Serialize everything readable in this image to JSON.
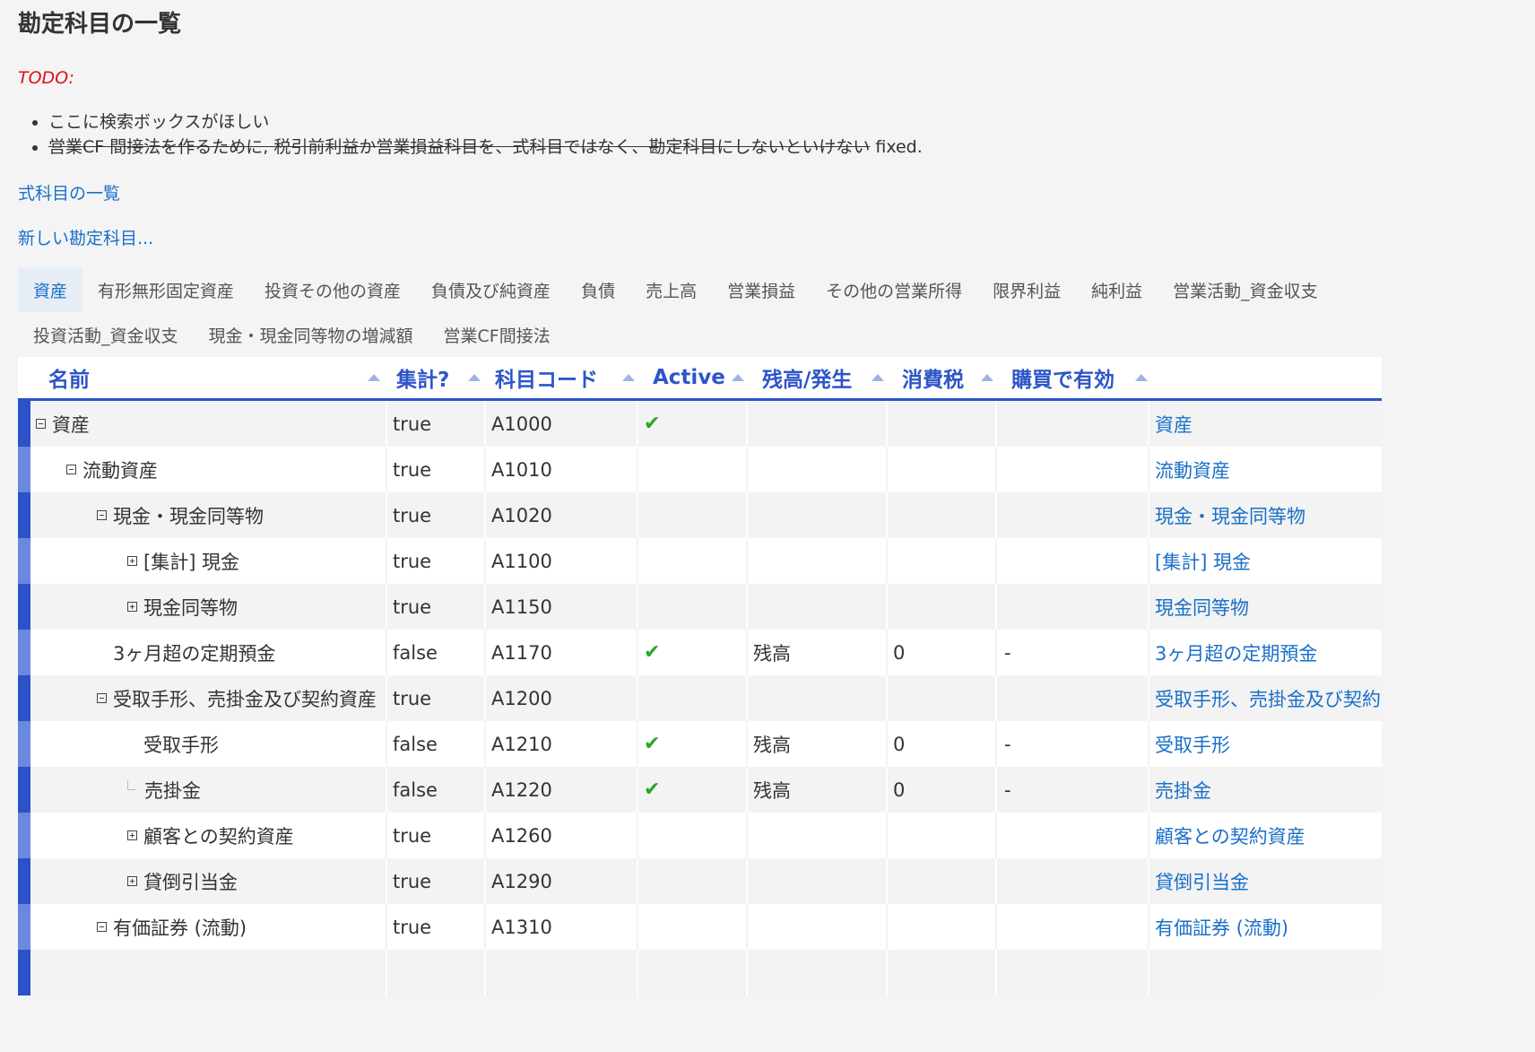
{
  "page": {
    "title": "勘定科目の一覧"
  },
  "todo": {
    "label": "TODO:",
    "items": [
      {
        "text": "ここに検索ボックスがほしい",
        "strike": "",
        "suffix": ""
      },
      {
        "text": "",
        "strike": "営業CF 間接法を作るために, 税引前利益か営業損益科目を、式科目ではなく、勘定科目にしないといけない",
        "suffix": " fixed."
      }
    ]
  },
  "links": {
    "formula_list": "式科目の一覧",
    "new_account": "新しい勘定科目..."
  },
  "tabs": [
    {
      "label": "資産",
      "active": true
    },
    {
      "label": "有形無形固定資産"
    },
    {
      "label": "投資その他の資産"
    },
    {
      "label": "負債及び純資産"
    },
    {
      "label": "負債"
    },
    {
      "label": "売上高"
    },
    {
      "label": "営業損益"
    },
    {
      "label": "その他の営業所得"
    },
    {
      "label": "限界利益"
    },
    {
      "label": "純利益"
    },
    {
      "label": "営業活動_資金収支"
    },
    {
      "label": "投資活動_資金収支"
    },
    {
      "label": "現金・現金同等物の増減額"
    },
    {
      "label": "営業CF間接法"
    }
  ],
  "columns": {
    "name": "名前",
    "aggregate": "集計?",
    "code": "科目コード",
    "active": "Active",
    "balance_type": "残高/発生",
    "tax": "消費税",
    "purchase": "購買で有効"
  },
  "icons": {
    "active_check": "✔"
  },
  "colors": {
    "accent": "#2b52c7",
    "link": "#1a6fc9",
    "todo": "#e01010",
    "check": "#2aa52a"
  },
  "rows": [
    {
      "indent": 0,
      "toggle": "minus",
      "name": "資産",
      "aggregate": "true",
      "code": "A1000",
      "active": true,
      "balance": "",
      "tax": "",
      "purchase": "",
      "link": "資産"
    },
    {
      "indent": 1,
      "toggle": "minus",
      "name": "流動資産",
      "aggregate": "true",
      "code": "A1010",
      "active": false,
      "balance": "",
      "tax": "",
      "purchase": "",
      "link": "流動資産"
    },
    {
      "indent": 2,
      "toggle": "minus",
      "name": "現金・現金同等物",
      "aggregate": "true",
      "code": "A1020",
      "active": false,
      "balance": "",
      "tax": "",
      "purchase": "",
      "link": "現金・現金同等物"
    },
    {
      "indent": 3,
      "toggle": "plus",
      "name": "[集計] 現金",
      "aggregate": "true",
      "code": "A1100",
      "active": false,
      "balance": "",
      "tax": "",
      "purchase": "",
      "link": "[集計] 現金"
    },
    {
      "indent": 3,
      "toggle": "plus",
      "name": "現金同等物",
      "aggregate": "true",
      "code": "A1150",
      "active": false,
      "balance": "",
      "tax": "",
      "purchase": "",
      "link": "現金同等物"
    },
    {
      "indent": 2,
      "toggle": "none",
      "name": "3ヶ月超の定期預金",
      "aggregate": "false",
      "code": "A1170",
      "active": true,
      "balance": "残高",
      "tax": "0",
      "purchase": "-",
      "link": "3ヶ月超の定期預金"
    },
    {
      "indent": 2,
      "toggle": "minus",
      "name": "受取手形、売掛金及び契約資産",
      "aggregate": "true",
      "code": "A1200",
      "active": false,
      "balance": "",
      "tax": "",
      "purchase": "",
      "link": "受取手形、売掛金及び契約資産"
    },
    {
      "indent": 3,
      "toggle": "none",
      "name": "受取手形",
      "aggregate": "false",
      "code": "A1210",
      "active": true,
      "balance": "残高",
      "tax": "0",
      "purchase": "-",
      "link": "受取手形"
    },
    {
      "indent": 3,
      "toggle": "leaf",
      "name": "売掛金",
      "aggregate": "false",
      "code": "A1220",
      "active": true,
      "balance": "残高",
      "tax": "0",
      "purchase": "-",
      "link": "売掛金"
    },
    {
      "indent": 3,
      "toggle": "plus",
      "name": "顧客との契約資産",
      "aggregate": "true",
      "code": "A1260",
      "active": false,
      "balance": "",
      "tax": "",
      "purchase": "",
      "link": "顧客との契約資産"
    },
    {
      "indent": 3,
      "toggle": "plus",
      "name": "貸倒引当金",
      "aggregate": "true",
      "code": "A1290",
      "active": false,
      "balance": "",
      "tax": "",
      "purchase": "",
      "link": "貸倒引当金"
    },
    {
      "indent": 2,
      "toggle": "minus",
      "name": "有価証券 (流動)",
      "aggregate": "true",
      "code": "A1310",
      "active": false,
      "balance": "",
      "tax": "",
      "purchase": "",
      "link": "有価証券 (流動)"
    },
    {
      "indent": 2,
      "toggle": "none",
      "name": "",
      "aggregate": "",
      "code": "",
      "active": false,
      "balance": "",
      "tax": "",
      "purchase": "",
      "link": ""
    }
  ]
}
